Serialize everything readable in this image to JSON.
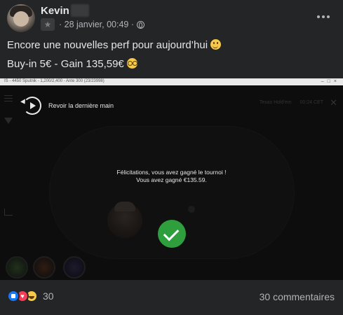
{
  "post": {
    "author": "Kevin",
    "timestamp": "· 28 janvier, 00:49 ·",
    "audience_icon": "globe-icon",
    "text_line1": "Encore une nouvelles perf pour aujourd’hui",
    "text_line1_emoji": "slightly-smiling-face",
    "text_line2": "Buy-in 5€ - Gain 135,59€",
    "text_line2_emoji": "nerd-face"
  },
  "screenshot": {
    "titlebar_text": "IS - 4450 Sputnik - 1,200/2,400 - Ante 300 (23/23998)",
    "replay_label": "Revoir la dernière main",
    "top_right_left": "Texas Hold'em",
    "top_right_right": "00:24 CET",
    "win_line1": "Félicitations, vous avez gagné le tournoi !",
    "win_line2": "Vous avez gagné €135.59.",
    "accent_color": "#2f9e3c"
  },
  "footer": {
    "reaction_icons": [
      "like-icon",
      "love-icon",
      "haha-icon"
    ],
    "reaction_count": "30",
    "comment_count": "30 commentaires"
  },
  "colors": {
    "background": "#242526",
    "text_primary": "#e4e6eb",
    "text_secondary": "#b0b3b8"
  }
}
